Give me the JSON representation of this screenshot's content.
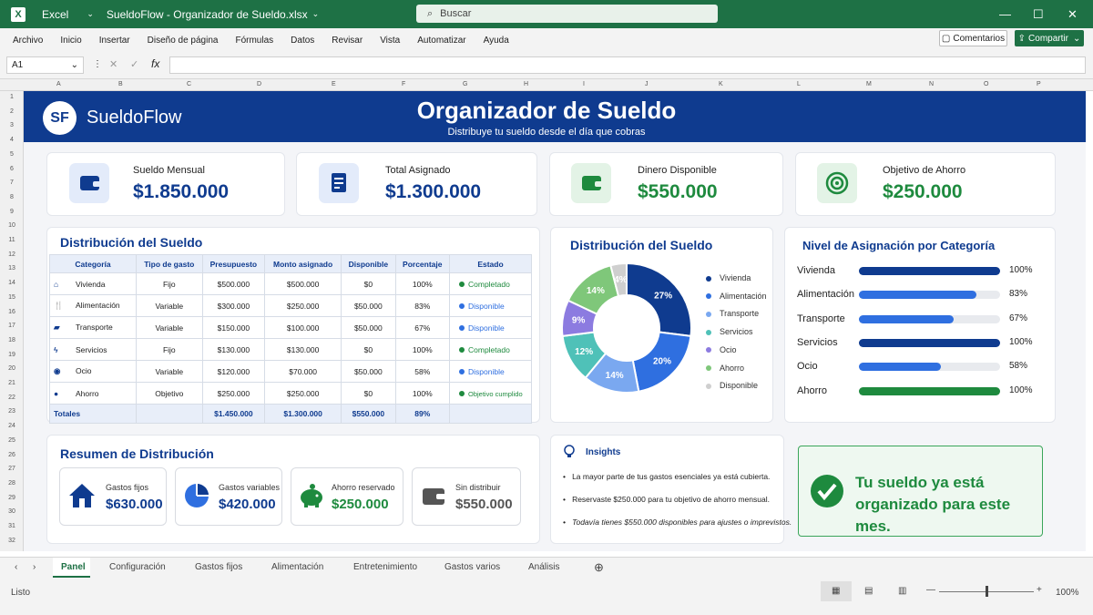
{
  "titlebar": {
    "app": "Excel",
    "file": "SueldoFlow - Organizador de Sueldo.xlsx",
    "search": "Buscar"
  },
  "menu": [
    "Archivo",
    "Inicio",
    "Insertar",
    "Diseño de página",
    "Fórmulas",
    "Datos",
    "Revisar",
    "Vista",
    "Automatizar",
    "Ayuda"
  ],
  "buttons": {
    "comments": "Comentarios",
    "share": "Compartir"
  },
  "namebox": "A1",
  "columns": [
    "A",
    "B",
    "C",
    "D",
    "E",
    "F",
    "G",
    "H",
    "I",
    "J",
    "K",
    "L",
    "M",
    "N",
    "O",
    "P"
  ],
  "rows": [
    "1",
    "2",
    "3",
    "4",
    "5",
    "6",
    "7",
    "8",
    "9",
    "10",
    "11",
    "12",
    "13",
    "14",
    "15",
    "16",
    "17",
    "18",
    "19",
    "20",
    "21",
    "22",
    "23",
    "24",
    "25",
    "26",
    "27",
    "28",
    "29",
    "30",
    "31",
    "32"
  ],
  "header": {
    "logo_text": "SF",
    "brand": "SueldoFlow",
    "title": "Organizador de Sueldo",
    "subtitle": "Distribuye tu sueldo desde el día que cobras"
  },
  "kpis": [
    {
      "label": "Sueldo Mensual",
      "value": "$1.850.000",
      "color": "#0f3b8f",
      "icon": "wallet-icon"
    },
    {
      "label": "Total Asignado",
      "value": "$1.300.000",
      "color": "#0f3b8f",
      "icon": "document-icon"
    },
    {
      "label": "Dinero Disponible",
      "value": "$550.000",
      "color": "#1e8a3e",
      "icon": "wallet-green-icon"
    },
    {
      "label": "Objetivo de Ahorro",
      "value": "$250.000",
      "color": "#1e8a3e",
      "icon": "target-icon"
    }
  ],
  "table": {
    "title": "Distribución del Sueldo",
    "headers": [
      "Categoría",
      "Tipo de gasto",
      "Presupuesto",
      "Monto asignado",
      "Disponible",
      "Porcentaje",
      "Estado"
    ],
    "rows": [
      {
        "cat": "Vivienda",
        "tipo": "Fijo",
        "pres": "$500.000",
        "monto": "$500.000",
        "disp": "$0",
        "pct": "100%",
        "estado": "Completado",
        "color": "#1e8a3e"
      },
      {
        "cat": "Alimentación",
        "tipo": "Variable",
        "pres": "$300.000",
        "monto": "$250.000",
        "disp": "$50.000",
        "pct": "83%",
        "estado": "Disponible",
        "color": "#2f6fe0"
      },
      {
        "cat": "Transporte",
        "tipo": "Variable",
        "pres": "$150.000",
        "monto": "$100.000",
        "disp": "$50.000",
        "pct": "67%",
        "estado": "Disponible",
        "color": "#2f6fe0"
      },
      {
        "cat": "Servicios",
        "tipo": "Fijo",
        "pres": "$130.000",
        "monto": "$130.000",
        "disp": "$0",
        "pct": "100%",
        "estado": "Completado",
        "color": "#1e8a3e"
      },
      {
        "cat": "Ocio",
        "tipo": "Variable",
        "pres": "$120.000",
        "monto": "$70.000",
        "disp": "$50.000",
        "pct": "58%",
        "estado": "Disponible",
        "color": "#2f6fe0"
      },
      {
        "cat": "Ahorro",
        "tipo": "Objetivo",
        "pres": "$250.000",
        "monto": "$250.000",
        "disp": "$0",
        "pct": "100%",
        "estado": "Objetivo cumplido",
        "color": "#1e8a3e"
      }
    ],
    "totals": {
      "label": "Totales",
      "pres": "$1.450.000",
      "monto": "$1.300.000",
      "disp": "$550.000",
      "pct": "89%"
    }
  },
  "chart_data": {
    "type": "pie",
    "title": "Distribución del Sueldo",
    "slices": [
      {
        "name": "Vivienda",
        "value": 27,
        "label": "27%",
        "color": "#0f3b8f"
      },
      {
        "name": "Alimentación",
        "value": 20,
        "label": "20%",
        "color": "#2f6fe0"
      },
      {
        "name": "Transporte",
        "value": 14,
        "label": "14%",
        "color": "#7aa8f0"
      },
      {
        "name": "Servicios",
        "value": 12,
        "label": "12%",
        "color": "#4fc1b8"
      },
      {
        "name": "Ocio",
        "value": 9,
        "label": "9%",
        "color": "#8c7be0"
      },
      {
        "name": "Ahorro",
        "value": 14,
        "label": "14%",
        "color": "#7fc77a"
      },
      {
        "name": "Disponible",
        "value": 4,
        "label": "4%",
        "color": "#cfcfcf"
      }
    ]
  },
  "levels": {
    "title": "Nivel de Asignación por Categoría",
    "items": [
      {
        "name": "Vivienda",
        "value": 100,
        "label": "100%",
        "color": "#0f3b8f"
      },
      {
        "name": "Alimentación",
        "value": 83,
        "label": "83%",
        "color": "#2f6fe0"
      },
      {
        "name": "Transporte",
        "value": 67,
        "label": "67%",
        "color": "#2f6fe0"
      },
      {
        "name": "Servicios",
        "value": 100,
        "label": "100%",
        "color": "#0f3b8f"
      },
      {
        "name": "Ocio",
        "value": 58,
        "label": "58%",
        "color": "#2f6fe0"
      },
      {
        "name": "Ahorro",
        "value": 100,
        "label": "100%",
        "color": "#1e8a3e"
      }
    ]
  },
  "summary": {
    "title": "Resumen de Distribución",
    "items": [
      {
        "label": "Gastos fijos",
        "value": "$630.000",
        "color": "#0f3b8f"
      },
      {
        "label": "Gastos variables",
        "value": "$420.000",
        "color": "#0f3b8f"
      },
      {
        "label": "Ahorro reservado",
        "value": "$250.000",
        "color": "#1e8a3e"
      },
      {
        "label": "Sin distribuir",
        "value": "$550.000",
        "color": "#555555"
      }
    ]
  },
  "insights": {
    "title": "Insights",
    "items": [
      "La mayor parte de tus gastos esenciales ya está cubierta.",
      "Reservaste $250.000 para tu objetivo de ahorro mensual.",
      "Todavía tienes $550.000 disponibles para ajustes o imprevistos."
    ]
  },
  "banner_msg": "Tu sueldo ya está organizado para este mes.",
  "sheets": [
    "Panel",
    "Configuración",
    "Gastos fijos",
    "Alimentación",
    "Entretenimiento",
    "Gastos varios",
    "Análisis"
  ],
  "status": {
    "ready": "Listo",
    "zoom": "100%"
  }
}
